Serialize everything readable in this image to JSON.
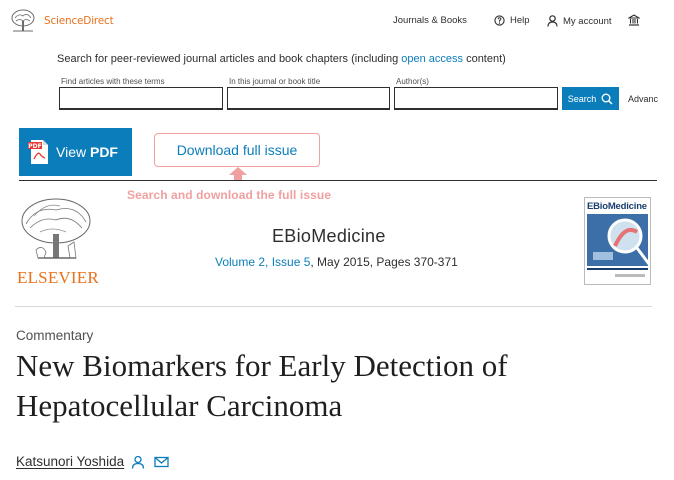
{
  "header": {
    "logo_text": "ScienceDirect",
    "nav": {
      "journals_books": "Journals & Books",
      "help": "Help",
      "my_account": "My account"
    }
  },
  "search": {
    "description_prefix": "Search for peer-reviewed journal articles and book chapters (including ",
    "open_access_link": "open access",
    "description_suffix": " content)",
    "fields": [
      {
        "label": "Find articles with these terms",
        "value": ""
      },
      {
        "label": "In this journal or book title",
        "value": ""
      },
      {
        "label": "Author(s)",
        "value": ""
      }
    ],
    "button_label": "Search",
    "advanced_label": "Advanc"
  },
  "actions": {
    "view_pdf_prefix": "View ",
    "view_pdf_bold": "PDF",
    "pdf_badge": "PDF",
    "download_full_issue": "Download full issue",
    "tooltip": "Search and download the full issue"
  },
  "journal": {
    "publisher": "ELSEVIER",
    "title": "EBioMedicine",
    "volume_issue": "Volume 2, Issue 5",
    "date_pages": ", May 2015, Pages 370-371",
    "cover_title": "EBioMedicine"
  },
  "article": {
    "type": "Commentary",
    "title": "New Biomarkers for Early Detection of Hepatocellular Carcinoma",
    "author": "Katsunori Yoshida"
  },
  "colors": {
    "brand_orange": "#e9711c",
    "link_blue": "#0c7dbb",
    "tooltip_pink": "#f0a0a0"
  }
}
